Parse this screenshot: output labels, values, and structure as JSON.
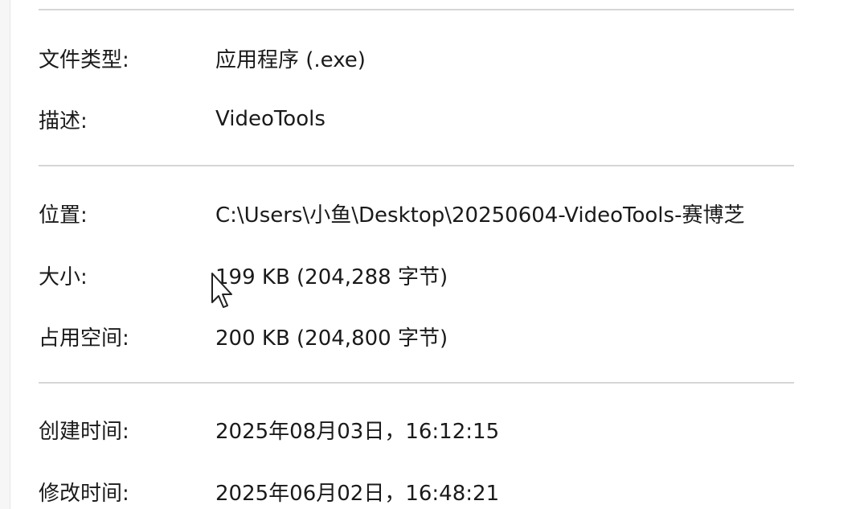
{
  "general": {
    "file_type_label": "文件类型:",
    "file_type_value": "应用程序 (.exe)",
    "description_label": "描述:",
    "description_value": "VideoTools"
  },
  "location_size": {
    "location_label": "位置:",
    "location_value": "C:\\Users\\小鱼\\Desktop\\20250604-VideoTools-赛博芝",
    "size_label": "大小:",
    "size_value": "199 KB (204,288 字节)",
    "disk_size_label": "占用空间:",
    "disk_size_value": "200 KB (204,800 字节)"
  },
  "timestamps": {
    "created_label": "创建时间:",
    "created_value": "2025年08月03日，16:12:15",
    "modified_label": "修改时间:",
    "modified_value": "2025年06月02日，16:48:21"
  },
  "cursor": {
    "icon": "mouse-pointer-icon"
  }
}
